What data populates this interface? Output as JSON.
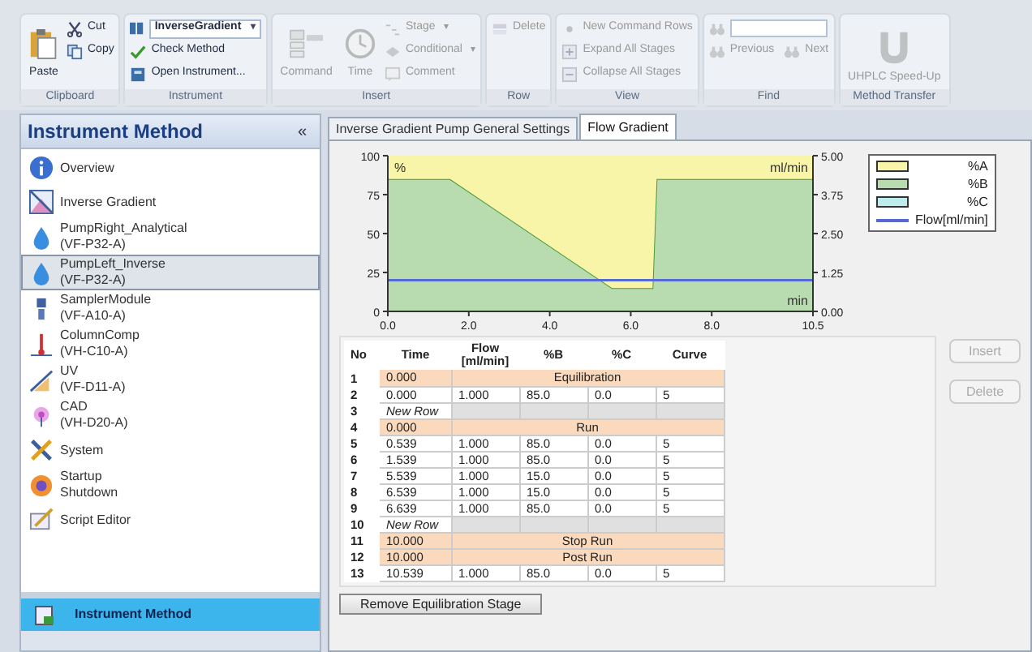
{
  "ribbon": {
    "groups": [
      {
        "label": "Clipboard",
        "columns": [
          [
            {
              "kind": "large",
              "label": "Paste",
              "disabled": false
            }
          ],
          [
            {
              "kind": "small",
              "label": "Cut",
              "disabled": false
            },
            {
              "kind": "small",
              "label": "Copy",
              "disabled": false
            }
          ]
        ]
      },
      {
        "label": "Instrument",
        "columns": [
          [
            {
              "kind": "dropdown",
              "label": "InverseGradient",
              "caret": "▾",
              "disabled": false
            },
            {
              "kind": "small",
              "label": "Check Method",
              "disabled": false
            },
            {
              "kind": "small",
              "label": "Open Instrument...",
              "disabled": false
            }
          ]
        ]
      },
      {
        "label": "Insert",
        "columns": [
          [
            {
              "kind": "large",
              "label": "Command",
              "disabled": true
            }
          ],
          [
            {
              "kind": "large",
              "label": "Time",
              "disabled": true
            }
          ],
          [
            {
              "kind": "small",
              "label": "Stage",
              "disabled": true,
              "caret": "▾"
            },
            {
              "kind": "small",
              "label": "Conditional",
              "disabled": true,
              "caret": "▾"
            },
            {
              "kind": "small",
              "label": "Comment",
              "disabled": true
            }
          ]
        ]
      },
      {
        "label": "Row",
        "columns": [
          [
            {
              "kind": "small",
              "label": "Delete",
              "disabled": true
            }
          ]
        ]
      },
      {
        "label": "View",
        "columns": [
          [
            {
              "kind": "small",
              "label": "New Command Rows",
              "disabled": true
            },
            {
              "kind": "small",
              "label": "Expand All Stages",
              "disabled": true
            },
            {
              "kind": "small",
              "label": "Collapse All Stages",
              "disabled": true
            }
          ]
        ]
      },
      {
        "label": "Find",
        "columns": [
          [
            {
              "kind": "field",
              "disabled": false
            },
            {
              "kind": "row",
              "items": [
                {
                  "kind": "small",
                  "label": "Previous",
                  "disabled": true
                },
                {
                  "kind": "small",
                  "label": "Next",
                  "disabled": true
                }
              ]
            }
          ]
        ]
      },
      {
        "label": "Method Transfer",
        "columns": [
          [
            {
              "kind": "large",
              "label": "UHPLC Speed-Up",
              "disabled": true
            }
          ]
        ]
      }
    ]
  },
  "sidebar": {
    "title": "Instrument Method",
    "collapse": "«",
    "items": [
      {
        "label": "Overview",
        "selected": false
      },
      {
        "label": "Inverse Gradient",
        "selected": false
      },
      {
        "label": "PumpRight_Analytical",
        "sublabel": "(VF-P32-A)",
        "selected": false
      },
      {
        "label": "PumpLeft_Inverse",
        "sublabel": "(VF-P32-A)",
        "selected": true
      },
      {
        "label": "SamplerModule",
        "sublabel": "(VF-A10-A)",
        "selected": false
      },
      {
        "label": "ColumnComp",
        "sublabel": "(VH-C10-A)",
        "selected": false
      },
      {
        "label": "UV",
        "sublabel": "(VF-D11-A)",
        "selected": false
      },
      {
        "label": "CAD",
        "sublabel": "(VH-D20-A)",
        "selected": false
      },
      {
        "label": "System",
        "selected": false
      },
      {
        "label": "Startup",
        "sublabel": "Shutdown",
        "selected": false
      },
      {
        "label": "Script Editor",
        "selected": false
      }
    ],
    "nav": [
      {
        "label": "Instrument Method",
        "selected": true
      }
    ]
  },
  "tabs": [
    {
      "label": "Inverse Gradient Pump General Settings",
      "selected": false
    },
    {
      "label": "Flow Gradient",
      "selected": true
    }
  ],
  "chart": {
    "right_axis_label": "ml/min",
    "unplotted_legend": [
      {
        "label": "%C",
        "color": "#bcecec"
      }
    ],
    "right_ticks": [
      "5.00",
      "3.75",
      "2.50",
      "1.25",
      "0.00"
    ],
    "chart_data": {
      "type": "area",
      "xlabel": "min",
      "ylabel": "%",
      "stacked": true,
      "x": [
        0,
        1.539,
        5.539,
        6.539,
        6.639,
        10.5
      ],
      "xlim": [
        0,
        10.5
      ],
      "ylim": [
        0,
        100
      ],
      "xticks": [
        {
          "value": 0,
          "label": "0.0"
        },
        {
          "value": 2,
          "label": "2.0"
        },
        {
          "value": 4,
          "label": "4.0"
        },
        {
          "value": 6,
          "label": "6.0"
        },
        {
          "value": 8,
          "label": "8.0"
        },
        {
          "value": 10.5,
          "label": "10.5"
        }
      ],
      "yticks": [
        0,
        25,
        50,
        75,
        100
      ],
      "series": [
        {
          "name": "%B",
          "color": "#b8dcb0",
          "values": [
            85,
            85,
            15,
            15,
            85,
            85
          ]
        },
        {
          "name": "%A",
          "color": "#f8f4a8",
          "values": [
            15,
            15,
            85,
            85,
            15,
            15
          ]
        }
      ],
      "ref_lines": [
        {
          "axis": "y",
          "value": 20,
          "label": "Flow[ml/min]",
          "color": "#5468d8"
        }
      ]
    }
  },
  "table": {
    "columns": [
      "No",
      "Time",
      "Flow\n[ml/min]",
      "%B",
      "%C",
      "Curve"
    ],
    "rows": [
      {
        "kind": "stage",
        "no": "1",
        "time": "0.000",
        "label": "Equilibration"
      },
      {
        "kind": "data",
        "no": "2",
        "time": "0.000",
        "flow": "1.000",
        "b": "85.0",
        "c": "0.0",
        "curve": "5"
      },
      {
        "kind": "new",
        "no": "3",
        "label": "New Row"
      },
      {
        "kind": "stage",
        "no": "4",
        "time": "0.000",
        "label": "Run"
      },
      {
        "kind": "data",
        "no": "5",
        "time": "0.539",
        "flow": "1.000",
        "b": "85.0",
        "c": "0.0",
        "curve": "5"
      },
      {
        "kind": "data",
        "no": "6",
        "time": "1.539",
        "flow": "1.000",
        "b": "85.0",
        "c": "0.0",
        "curve": "5"
      },
      {
        "kind": "data",
        "no": "7",
        "time": "5.539",
        "flow": "1.000",
        "b": "15.0",
        "c": "0.0",
        "curve": "5"
      },
      {
        "kind": "data",
        "no": "8",
        "time": "6.539",
        "flow": "1.000",
        "b": "15.0",
        "c": "0.0",
        "curve": "5"
      },
      {
        "kind": "data",
        "no": "9",
        "time": "6.639",
        "flow": "1.000",
        "b": "85.0",
        "c": "0.0",
        "curve": "5"
      },
      {
        "kind": "new",
        "no": "10",
        "label": "New Row"
      },
      {
        "kind": "stage",
        "no": "11",
        "time": "10.000",
        "label": "Stop Run"
      },
      {
        "kind": "stage",
        "no": "12",
        "time": "10.000",
        "label": "Post Run"
      },
      {
        "kind": "data",
        "no": "13",
        "time": "10.539",
        "flow": "1.000",
        "b": "85.0",
        "c": "0.0",
        "curve": "5"
      }
    ]
  },
  "side_buttons": [
    {
      "label": "Insert",
      "disabled": true
    },
    {
      "label": "Delete",
      "disabled": true
    }
  ],
  "bottom_button": {
    "label": "Remove Equilibration Stage"
  }
}
